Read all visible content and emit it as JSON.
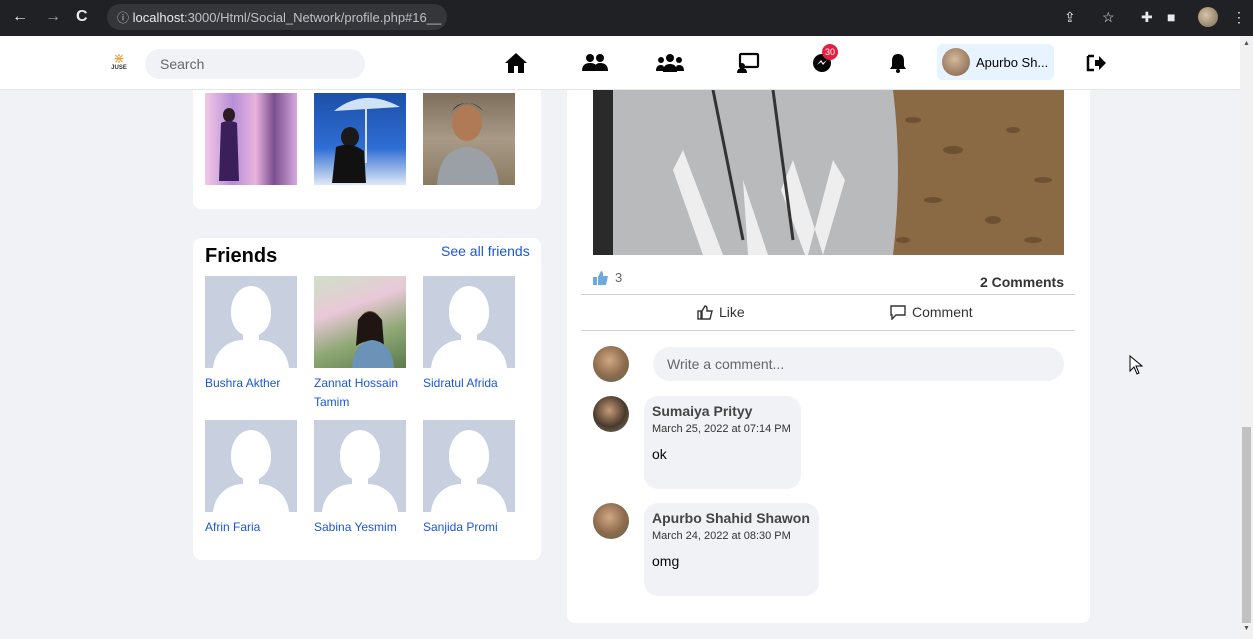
{
  "browser": {
    "url_host": "localhost",
    "url_rest": ":3000/Html/Social_Network/profile.php#16__"
  },
  "nav": {
    "logo_text": "JUSE",
    "search_placeholder": "Search",
    "messages_badge": "30",
    "profile_name": "Apurbo Sh..."
  },
  "friends": {
    "title": "Friends",
    "see_all": "See all friends",
    "items": [
      {
        "name": "Bushra Akther"
      },
      {
        "name": "Zannat Hossain Tamim"
      },
      {
        "name": "Sidratul Afrida"
      },
      {
        "name": "Afrin Faria"
      },
      {
        "name": "Sabina Yesmim"
      },
      {
        "name": "Sanjida Promi"
      }
    ]
  },
  "post": {
    "like_count": "3",
    "comments_count": "2 Comments",
    "like_label": "Like",
    "comment_label": "Comment",
    "comment_placeholder": "Write a comment...",
    "comments": [
      {
        "author": "Sumaiya Prityy",
        "time": "March 25, 2022 at 07:14 PM",
        "text": "ok"
      },
      {
        "author": "Apurbo Shahid Shawon",
        "time": "March 24, 2022 at 08:30 PM",
        "text": "omg"
      }
    ]
  },
  "colors": {
    "accent": "#1a56db",
    "badge": "#e41e3f",
    "chip": "#e7f3ff"
  }
}
